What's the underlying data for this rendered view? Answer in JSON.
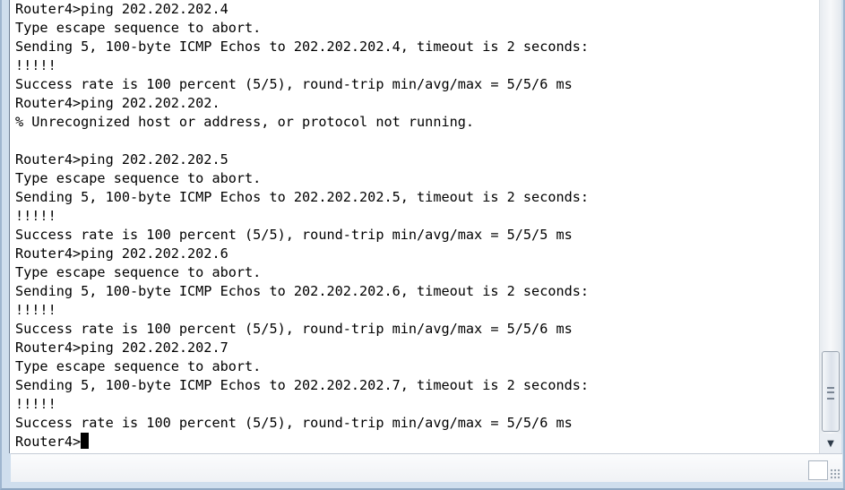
{
  "terminal": {
    "lines": [
      "Router4>ping 202.202.202.4",
      "Type escape sequence to abort.",
      "Sending 5, 100-byte ICMP Echos to 202.202.202.4, timeout is 2 seconds:",
      "!!!!!",
      "Success rate is 100 percent (5/5), round-trip min/avg/max = 5/5/6 ms",
      "Router4>ping 202.202.202.",
      "% Unrecognized host or address, or protocol not running.",
      "",
      "Router4>ping 202.202.202.5",
      "Type escape sequence to abort.",
      "Sending 5, 100-byte ICMP Echos to 202.202.202.5, timeout is 2 seconds:",
      "!!!!!",
      "Success rate is 100 percent (5/5), round-trip min/avg/max = 5/5/5 ms",
      "Router4>ping 202.202.202.6",
      "Type escape sequence to abort.",
      "Sending 5, 100-byte ICMP Echos to 202.202.202.6, timeout is 2 seconds:",
      "!!!!!",
      "Success rate is 100 percent (5/5), round-trip min/avg/max = 5/5/6 ms",
      "Router4>ping 202.202.202.7",
      "Type escape sequence to abort.",
      "Sending 5, 100-byte ICMP Echos to 202.202.202.7, timeout is 2 seconds:",
      "!!!!!",
      "Success rate is 100 percent (5/5), round-trip min/avg/max = 5/5/6 ms"
    ],
    "prompt": "Router4>"
  },
  "icons": {
    "scroll_down": "chevron-down-icon",
    "scroll_grip": "grip-icon",
    "resize_grip": "resize-grip-icon"
  },
  "colors": {
    "terminal_background": "#ffffff",
    "text": "#000000",
    "window_frame": "#cfdeed"
  }
}
